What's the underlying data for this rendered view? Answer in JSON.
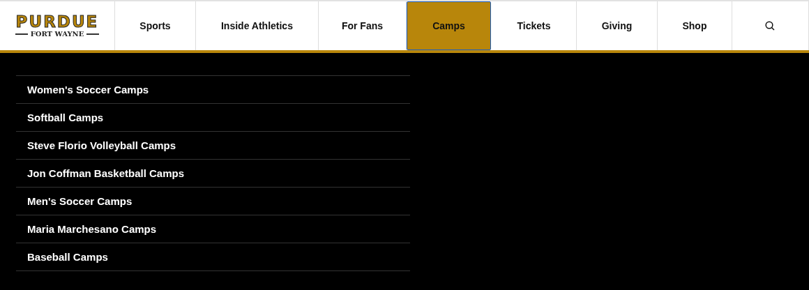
{
  "logo": {
    "title": "PURDUE",
    "subtitle": "FORT WAYNE"
  },
  "nav": [
    {
      "label": "Sports",
      "selected": false
    },
    {
      "label": "Inside Athletics",
      "selected": false
    },
    {
      "label": "For Fans",
      "selected": false
    },
    {
      "label": "Camps",
      "selected": true
    },
    {
      "label": "Tickets",
      "selected": false
    },
    {
      "label": "Giving",
      "selected": false
    },
    {
      "label": "Shop",
      "selected": false
    }
  ],
  "dropdown": {
    "items": [
      "Women's Soccer Camps",
      "Softball Camps",
      "Steve Florio Volleyball Camps",
      "Jon Coffman Basketball Camps",
      "Men's Soccer Camps",
      "Maria Marchesano Camps",
      "Baseball Camps"
    ]
  }
}
